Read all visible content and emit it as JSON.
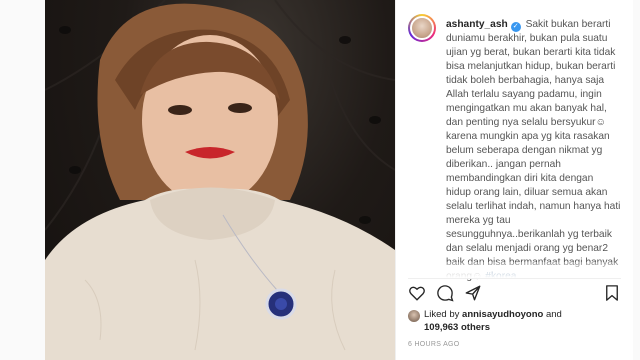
{
  "post": {
    "username": "ashanty_ash",
    "caption_lines": [
      "Sakit bukan berarti",
      "duniamu berakhir, bukan pula suatu",
      "ujian yg berat, bukan berarti kita tidak",
      "bisa melanjutkan hidup, bukan berarti",
      "tidak boleh berbahagia, hanya saja",
      "Allah terlalu sayang padamu, ingin",
      "mengingatkan mu akan banyak hal,",
      "dan penting nya selalu bersyukur☺",
      "karena mungkin apa yg kita rasakan",
      "belum seberapa dengan nikmat yg",
      "diberikan.. jangan pernah",
      "membandingkan diri kita dengan",
      "hidup orang lain, diluar semua akan",
      "selalu terlihat indah, namun hanya hati",
      "mereka yg tau",
      "sesungguhnya..berikanlah yg terbaik",
      "dan selalu menjadi orang yg benar2",
      "baik dan bisa bermanfaat bagi banyak"
    ],
    "caption_last": "orang☺ ",
    "hashtag": "#korea"
  },
  "actions": {
    "like_icon": "heart-icon",
    "comment_icon": "comment-icon",
    "share_icon": "share-icon",
    "save_icon": "bookmark-icon"
  },
  "likes": {
    "prefix": "Liked by ",
    "liked_by": "annisayudhoyono",
    "and": " and",
    "count": "109,963 others"
  },
  "timestamp": "6 HOURS AGO",
  "colors": {
    "link": "#003569",
    "verified": "#3897f0",
    "text": "#262626",
    "muted": "#999999"
  }
}
